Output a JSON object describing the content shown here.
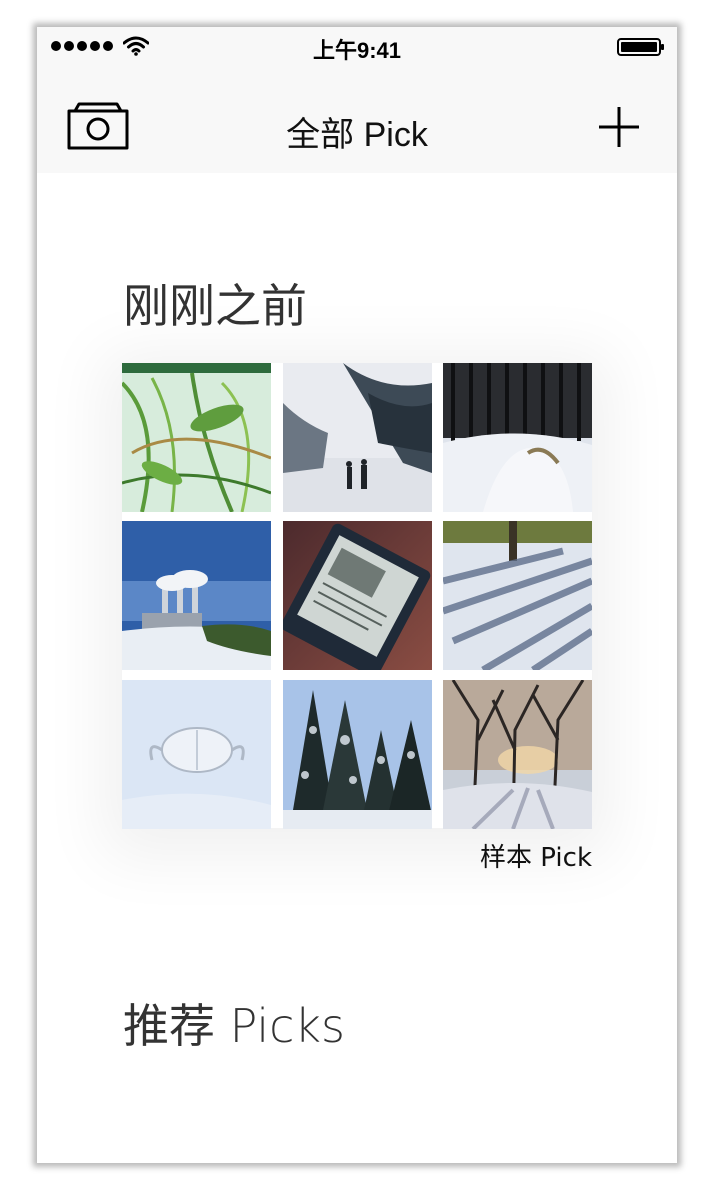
{
  "status_bar": {
    "time": "上午9:41",
    "signal_bars": 5,
    "icons": [
      "signal-icon",
      "wifi-icon",
      "battery-icon"
    ]
  },
  "nav_bar": {
    "title": "全部 Pick",
    "left_icon": "camera-icon",
    "right_icon": "plus-icon"
  },
  "sections": {
    "recent": {
      "title": "刚刚之前",
      "pick_label": "样本 Pick",
      "photos": [
        "grass-in-snow-photo",
        "snowy-road-walkers-photo",
        "iron-fence-snow-photo",
        "power-plant-skyline-photo",
        "kindle-reader-photo",
        "tree-shadows-snow-photo",
        "mask-in-snow-photo",
        "pine-trees-snow-photo",
        "sunset-bare-trees-photo"
      ]
    },
    "recommended": {
      "title": "推荐 Picks"
    }
  }
}
